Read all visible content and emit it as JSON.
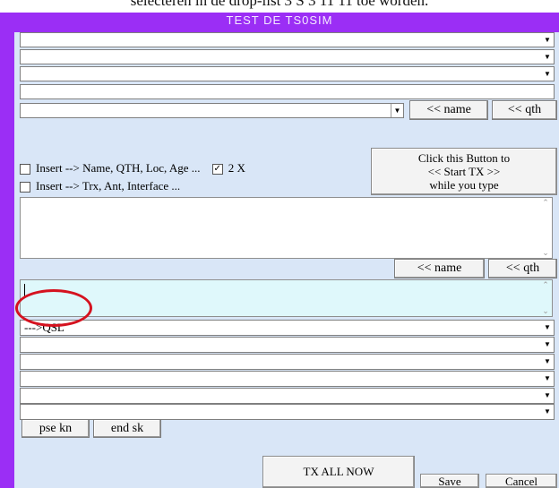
{
  "caption": "selecteren in de drop-list 3 S 3 11 11 toe worden.",
  "window": {
    "title": "TEST  DE  TS0SIM"
  },
  "checks": {
    "insert_name": "Insert --> Name, QTH, Loc, Age ...",
    "insert_trx": "Insert --> Trx, Ant, Interface ...",
    "two_x": "2 X",
    "two_x_checked": "✓"
  },
  "buttons": {
    "name_top": "<< name",
    "qth_top": "<< qth",
    "start_tx": "Click this Button to\n<< Start TX >>\nwhile you type",
    "name_mid": "<< name",
    "qth_mid": "<< qth",
    "pse_kn": "pse kn",
    "end_sk": "end sk",
    "tx_all_now": "TX  ALL  NOW",
    "save": "Save",
    "cancel": "Cancel"
  },
  "macro_rows": [
    "--->QSL",
    "",
    "",
    "",
    "",
    ""
  ],
  "colors": {
    "frame": "#9b2ef5",
    "client": "#d9e6f7",
    "input": "#dff8fb",
    "annotation": "#d5121f"
  }
}
